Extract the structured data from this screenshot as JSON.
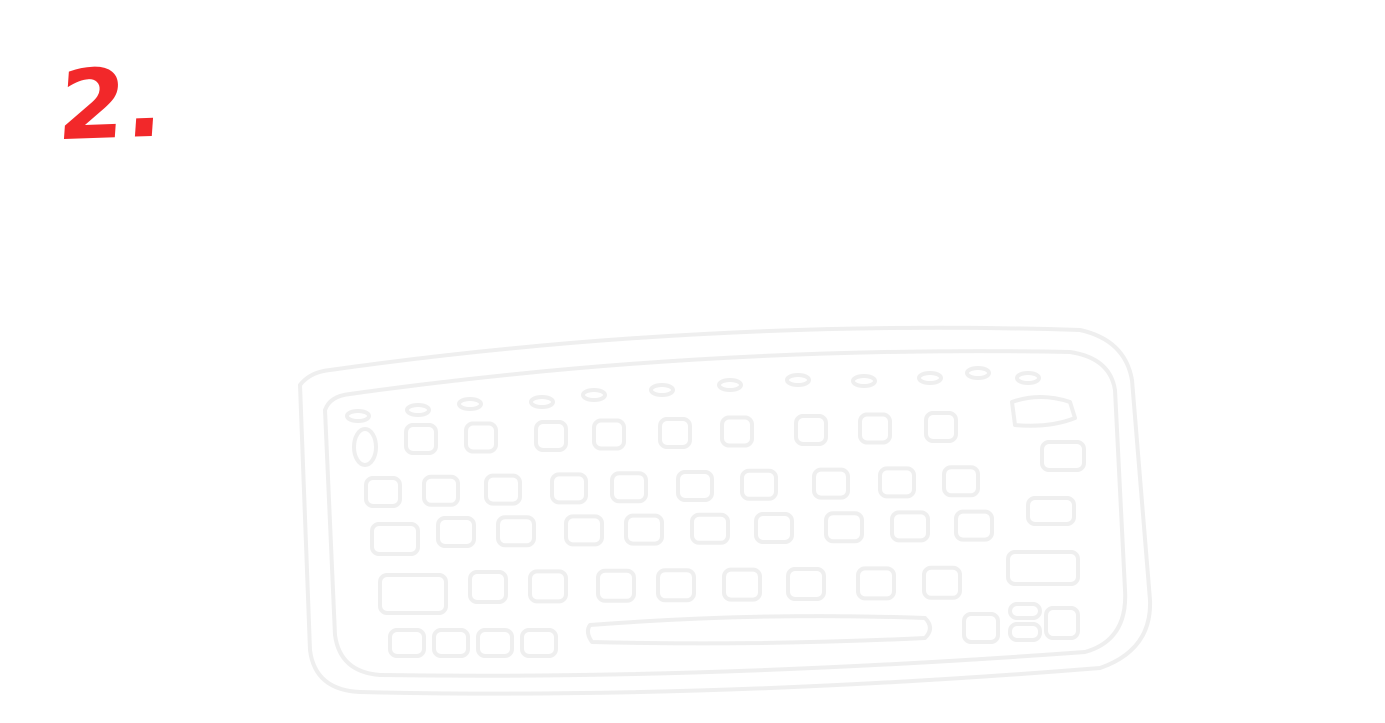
{
  "step": {
    "label": "2."
  },
  "colors": {
    "step_number": "#f2282a",
    "sketch_stroke": "#efefef",
    "background": "#ffffff"
  },
  "illustration": {
    "icon": "keyboard-sketch-icon"
  }
}
